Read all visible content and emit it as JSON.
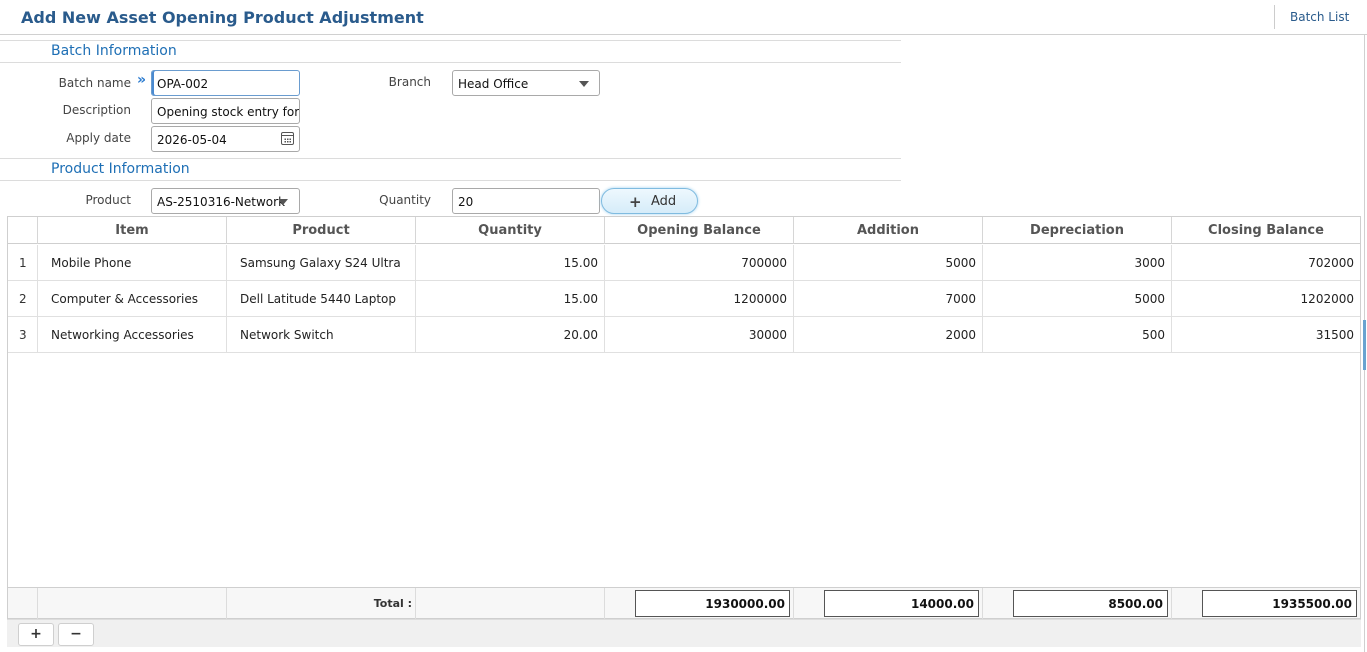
{
  "header": {
    "title": "Add New Asset Opening Product Adjustment",
    "batch_list_label": "Batch List"
  },
  "batch_section": {
    "title": "Batch Information",
    "batch_name_label": "Batch name",
    "batch_name_value": "OPA-002",
    "description_label": "Description",
    "description_value": "Opening stock entry for",
    "apply_date_label": "Apply date",
    "apply_date_value": "2026-05-04",
    "branch_label": "Branch",
    "branch_value": "Head Office"
  },
  "product_section": {
    "title": "Product Information",
    "product_label": "Product",
    "product_value": "AS-2510316-Network",
    "quantity_label": "Quantity",
    "quantity_value": "20",
    "add_label": "Add"
  },
  "table": {
    "columns": [
      "Item",
      "Product",
      "Quantity",
      "Opening Balance",
      "Addition",
      "Depreciation",
      "Closing Balance"
    ],
    "rows": [
      {
        "no": "1",
        "item": "Mobile Phone",
        "product": "Samsung Galaxy S24 Ultra",
        "quantity": "15.00",
        "opening": "700000",
        "addition": "5000",
        "depreciation": "3000",
        "closing": "702000"
      },
      {
        "no": "2",
        "item": "Computer & Accessories",
        "product": "Dell Latitude 5440 Laptop",
        "quantity": "15.00",
        "opening": "1200000",
        "addition": "7000",
        "depreciation": "5000",
        "closing": "1202000"
      },
      {
        "no": "3",
        "item": "Networking Accessories",
        "product": "Network Switch",
        "quantity": "20.00",
        "opening": "30000",
        "addition": "2000",
        "depreciation": "500",
        "closing": "31500"
      }
    ],
    "total_label": "Total :",
    "totals": {
      "opening": "1930000.00",
      "addition": "14000.00",
      "depreciation": "8500.00",
      "closing": "1935500.00"
    }
  },
  "footer": {
    "add_row_label": "+",
    "remove_row_label": "−"
  }
}
